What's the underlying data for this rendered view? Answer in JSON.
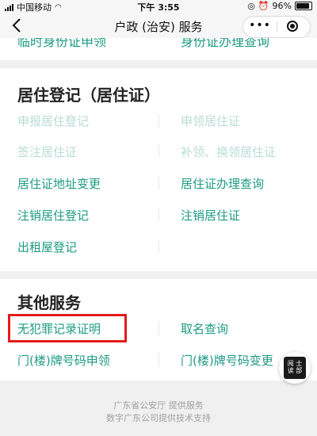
{
  "status_bar": {
    "carrier": "中国移动",
    "time": "下午 3:55",
    "battery": "96%"
  },
  "nav": {
    "back_icon": "chevron-left-icon",
    "title": "户政 (治安) 服务",
    "more_label": "•••",
    "close_icon": "target-close-icon"
  },
  "top_partial": {
    "left": "临时身份证申领",
    "right": "身份证办理查询"
  },
  "residence": {
    "title": "居住登记（居住证）",
    "items": [
      {
        "label": "申报居住登记",
        "disabled": true
      },
      {
        "label": "申领居住证",
        "disabled": true
      },
      {
        "label": "签注居住证",
        "disabled": true
      },
      {
        "label": "补领、换领居住证",
        "disabled": true
      },
      {
        "label": "居住证地址变更",
        "disabled": false
      },
      {
        "label": "居住证办理查询",
        "disabled": false
      },
      {
        "label": "注销居住登记",
        "disabled": false
      },
      {
        "label": "注销居住证",
        "disabled": false
      },
      {
        "label": "出租屋登记",
        "disabled": false
      }
    ]
  },
  "other": {
    "title": "其他服务",
    "items": [
      {
        "label": "无犯罪记录证明"
      },
      {
        "label": "取名查询"
      },
      {
        "label": "门(楼)牌号码申领"
      },
      {
        "label": "门(楼)牌号码变更"
      }
    ]
  },
  "footer": {
    "line1": "广东省公安厅 提供服务",
    "line2": "数字广东公司提供技术支持"
  },
  "badge": {
    "text": "阅 士 读 部"
  },
  "colors": {
    "accent": "#1d9a83",
    "accent_disabled": "#b8dcd3",
    "highlight": "#e61a1a"
  }
}
